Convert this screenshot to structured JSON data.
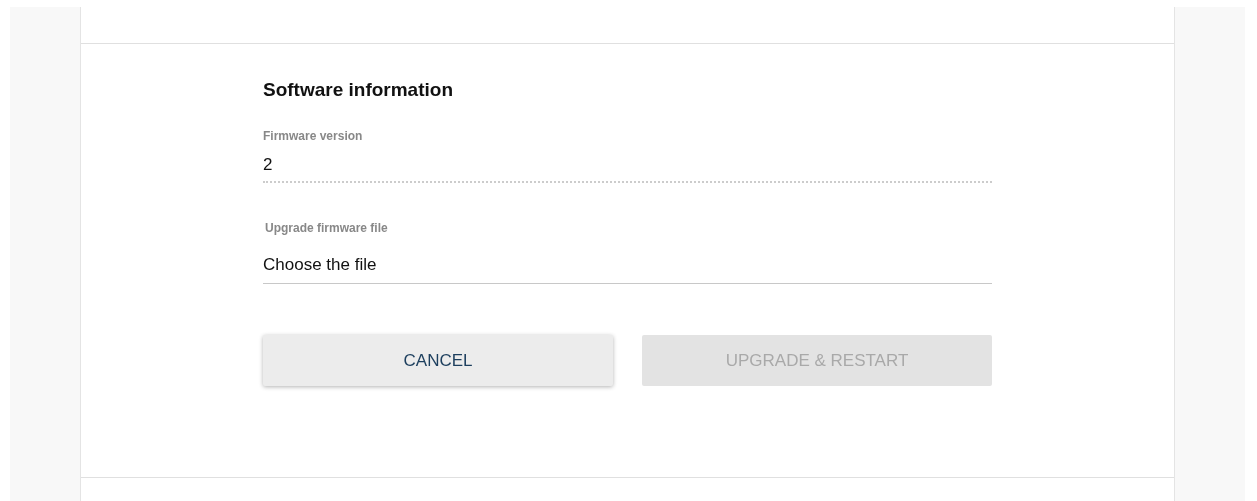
{
  "section": {
    "title": "Software information"
  },
  "fields": [
    {
      "kind": "readonly",
      "label": "Firmware version",
      "value": "2"
    },
    {
      "kind": "file",
      "label": "Upgrade firmware file",
      "value": "Choose the file"
    }
  ],
  "buttons": [
    {
      "label": "CANCEL",
      "disabled": false
    },
    {
      "label": "UPGRADE & RESTART",
      "disabled": true
    }
  ]
}
